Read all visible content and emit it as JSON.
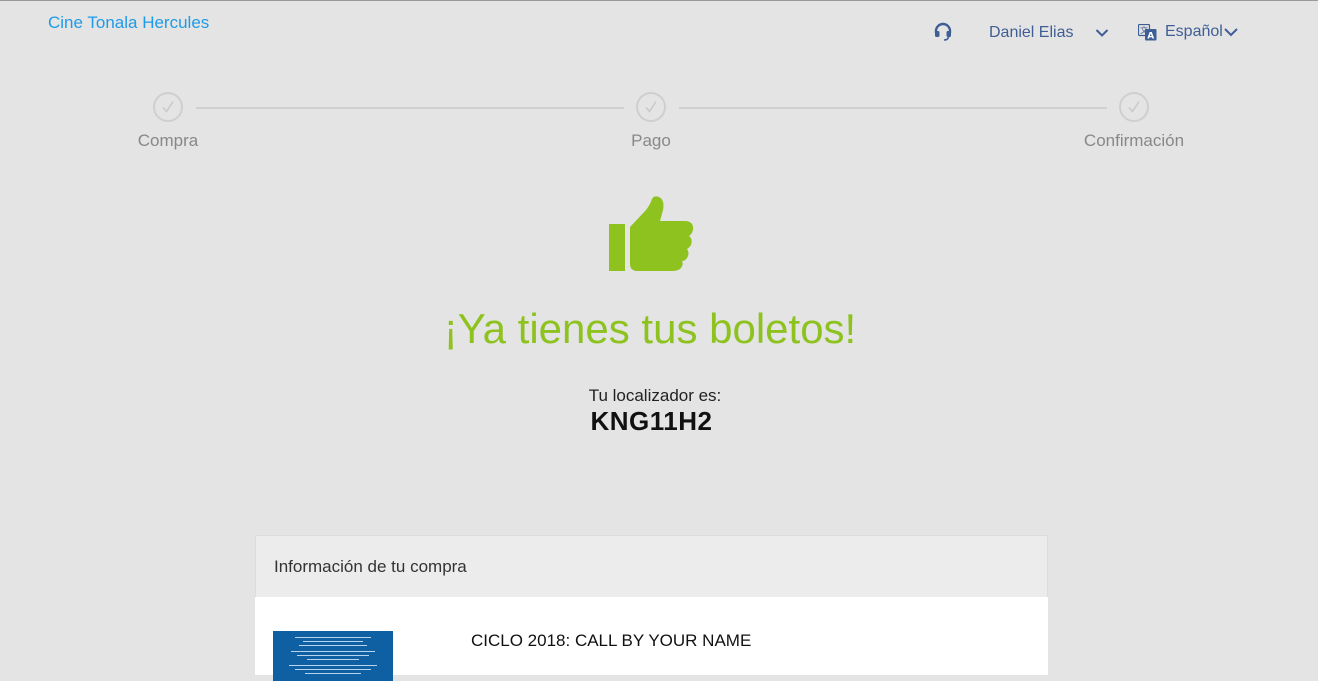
{
  "header": {
    "brand": "Cine Tonala Hercules",
    "support_icon": "headset-icon",
    "user_name": "Daniel Elias",
    "language": "Español",
    "language_icon": "translate-icon",
    "accent_color": "#1e9be8",
    "nav_color": "#3f5e95"
  },
  "stepper": {
    "steps": [
      {
        "label": "Compra",
        "icon": "check-icon",
        "completed": true
      },
      {
        "label": "Pago",
        "icon": "check-icon",
        "completed": true
      },
      {
        "label": "Confirmación",
        "icon": "check-icon",
        "completed": true
      }
    ]
  },
  "confirmation": {
    "icon": "thumbs-up-icon",
    "title": "¡Ya tienes tus boletos!",
    "locator_label": "Tu localizador es:",
    "locator_code": "KNG11H2",
    "success_color": "#8dc21f"
  },
  "purchase": {
    "header": "Información de tu compra",
    "movie_title": "CICLO 2018: CALL BY YOUR NAME",
    "poster_color": "#0f5fa3"
  }
}
